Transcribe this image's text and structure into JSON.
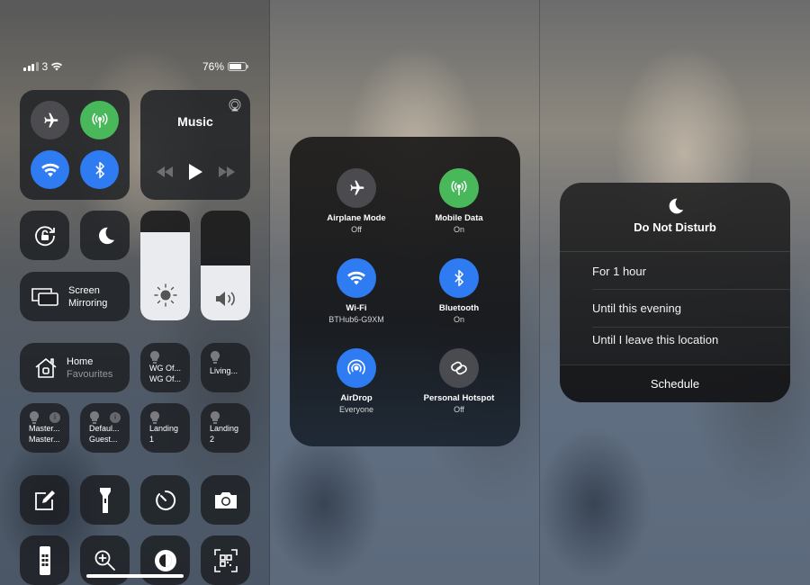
{
  "status_bar": {
    "carrier": "3",
    "battery": "76%",
    "battery_level": 0.76
  },
  "control_center": {
    "connectivity": [
      {
        "id": "airplane",
        "icon": "airplane-icon",
        "on": false
      },
      {
        "id": "cellular",
        "icon": "antenna-icon",
        "on": true
      },
      {
        "id": "wifi",
        "icon": "wifi-icon",
        "on": true
      },
      {
        "id": "bluetooth",
        "icon": "bluetooth-icon",
        "on": true
      }
    ],
    "music": {
      "title": "Music"
    },
    "orientation_lock": {
      "icon": "rotation-lock-icon"
    },
    "do_not_disturb": {
      "icon": "moon-icon"
    },
    "brightness": {
      "level": 0.8
    },
    "volume": {
      "level": 0.5
    },
    "screen_mirroring": {
      "line1": "Screen",
      "line2": "Mirroring"
    },
    "home": {
      "title": "Home",
      "subtitle": "Favourites"
    },
    "accessories": [
      {
        "line1": "WG Of...",
        "line2": "WG Of..."
      },
      {
        "line1": "Living...",
        "line2": ""
      },
      {
        "line1": "Master...",
        "line2": "Master...",
        "info": true
      },
      {
        "line1": "Defaul...",
        "line2": "Guest...",
        "info": true
      },
      {
        "line1": "Landing",
        "line2": "1"
      },
      {
        "line1": "Landing",
        "line2": "2"
      }
    ],
    "shortcuts_row1": [
      "notes-icon",
      "flashlight-icon",
      "timer-icon",
      "camera-icon"
    ],
    "shortcuts_row2": [
      "remote-icon",
      "magnifier-icon",
      "dark-mode-icon",
      "qr-scanner-icon"
    ]
  },
  "connectivity_expanded": {
    "items": [
      {
        "name": "Airplane Mode",
        "state": "Off"
      },
      {
        "name": "Mobile Data",
        "state": "On"
      },
      {
        "name": "Wi-Fi",
        "state": "BTHub6-G9XM"
      },
      {
        "name": "Bluetooth",
        "state": "On"
      },
      {
        "name": "AirDrop",
        "state": "Everyone"
      },
      {
        "name": "Personal Hotspot",
        "state": "Off"
      }
    ]
  },
  "dnd_menu": {
    "title": "Do Not Disturb",
    "options": [
      "For 1 hour",
      "Until this evening",
      "Until I leave this location"
    ],
    "schedule": "Schedule"
  },
  "colors": {
    "blue": "#2f7bf2",
    "green": "#49b85a"
  }
}
